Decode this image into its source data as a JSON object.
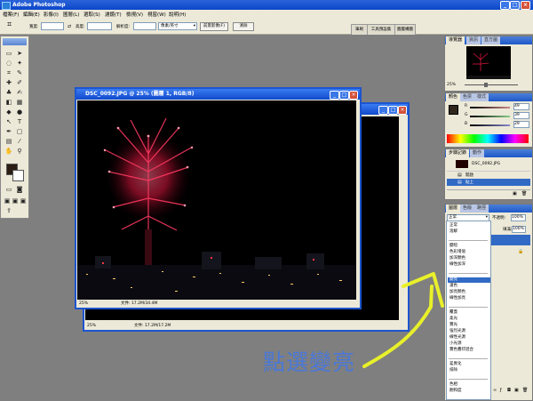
{
  "app": {
    "title": "Adobe Photoshop"
  },
  "menu": [
    "檔案(F)",
    "編輯(E)",
    "影像(I)",
    "圖層(L)",
    "選取(S)",
    "濾鏡(T)",
    "檢視(V)",
    "視窗(W)",
    "說明(H)"
  ],
  "options": {
    "width_label": "寬度:",
    "height_label": "高度:",
    "resolution_label": "解析度:",
    "unit": "像素/英寸",
    "front_image_btn": "前景影像(F)",
    "clear_btn": "清除"
  },
  "well_tabs": [
    "筆刷",
    "工具預設集",
    "圖層構圖"
  ],
  "doc_front": {
    "title": "DSC_0092.JPG @ 25% (圖層 1, RGB/8)",
    "zoom": "25%",
    "filesize": "文件: 17.2M/34.4M"
  },
  "doc_back": {
    "zoom": "25%",
    "filesize": "文件: 17.2M/17.2M"
  },
  "navigator": {
    "tabs": [
      "導覽器",
      "資訊",
      "直方圖"
    ],
    "zoom": "25%"
  },
  "color": {
    "tabs": [
      "顏色",
      "色票",
      "樣式"
    ],
    "r_label": "R",
    "g_label": "G",
    "b_label": "B",
    "r": "49",
    "g": "39",
    "b": "29"
  },
  "history": {
    "tabs": [
      "步驟記錄",
      "動作"
    ],
    "items": [
      "DSC_0092.JPG",
      "開啟",
      "貼上"
    ]
  },
  "layers": {
    "tabs": [
      "圖層",
      "色版",
      "路徑"
    ],
    "blend_mode": "正常",
    "opacity_label": "不透明:",
    "opacity": "100%",
    "fill_label": "填滿:",
    "fill": "100%",
    "menu_groups": [
      [
        "正常",
        "溶解"
      ],
      [
        "變暗",
        "色彩增值",
        "加深顏色",
        "線性加深"
      ],
      [
        "變亮",
        "濾色",
        "加亮顏色",
        "線性加亮"
      ],
      [
        "覆蓋",
        "柔光",
        "實光",
        "強烈光源",
        "線性光源",
        "小光源",
        "實色疊印混合"
      ],
      [
        "差異化",
        "排除"
      ],
      [
        "色相",
        "飽和度"
      ]
    ],
    "selected": "變亮"
  },
  "annotation": {
    "text": "點選變亮",
    "color": "#4a78d8",
    "arrow_color": "#e8f02a"
  }
}
